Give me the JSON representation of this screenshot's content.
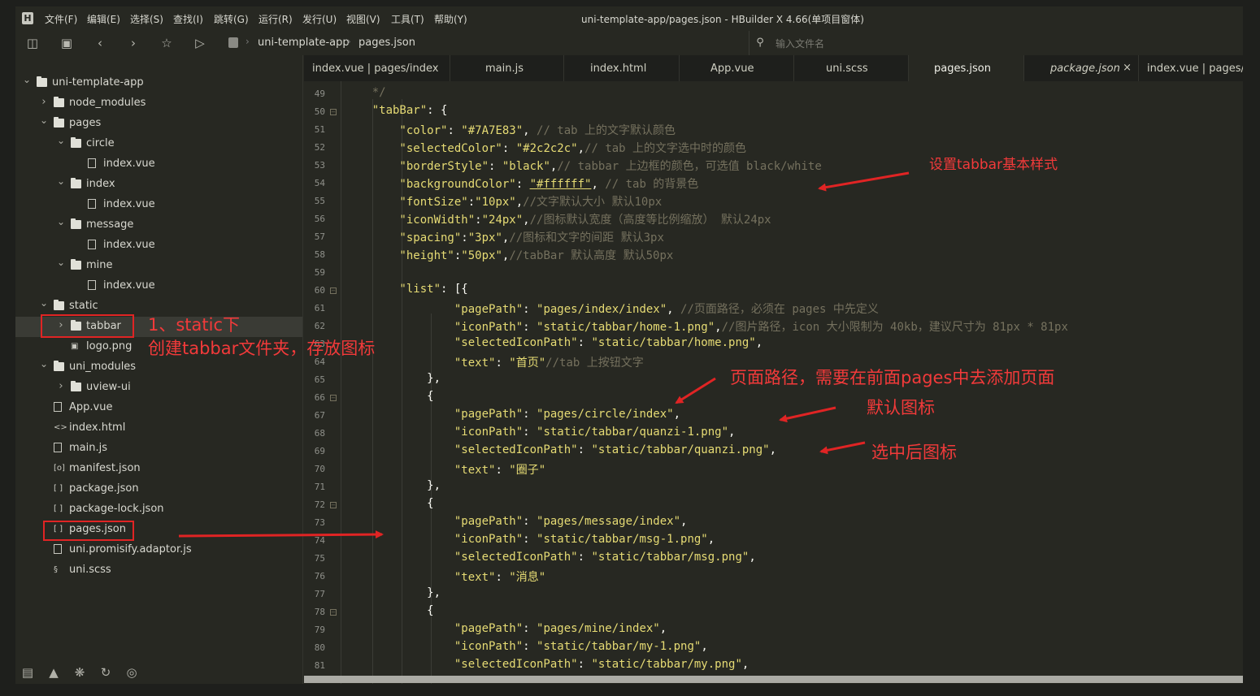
{
  "menubar": {
    "logo": "H",
    "items": [
      "文件(F)",
      "编辑(E)",
      "选择(S)",
      "查找(I)",
      "跳转(G)",
      "运行(R)",
      "发行(U)",
      "视图(V)",
      "工具(T)",
      "帮助(Y)"
    ],
    "window_title": "uni-template-app/pages.json - HBuilder X 4.66(单项目窗体)"
  },
  "toolbar": {
    "breadcrumb": [
      "uni-template-app",
      "pages.json"
    ],
    "file_search_placeholder": "输入文件名"
  },
  "sidebar": {
    "tree": [
      {
        "label": "uni-template-app",
        "kind": "folder",
        "expanded": true
      },
      {
        "label": "node_modules",
        "kind": "folder",
        "expanded": false
      },
      {
        "label": "pages",
        "kind": "folder",
        "expanded": true
      },
      {
        "label": "circle",
        "kind": "folder",
        "expanded": true
      },
      {
        "label": "index.vue",
        "kind": "vue"
      },
      {
        "label": "index",
        "kind": "folder",
        "expanded": true
      },
      {
        "label": "index.vue",
        "kind": "vue"
      },
      {
        "label": "message",
        "kind": "folder",
        "expanded": true
      },
      {
        "label": "index.vue",
        "kind": "vue"
      },
      {
        "label": "mine",
        "kind": "folder",
        "expanded": true
      },
      {
        "label": "index.vue",
        "kind": "vue"
      },
      {
        "label": "static",
        "kind": "folder",
        "expanded": true
      },
      {
        "label": "tabbar",
        "kind": "folder",
        "expanded": false,
        "selected": true
      },
      {
        "label": "logo.png",
        "kind": "image"
      },
      {
        "label": "uni_modules",
        "kind": "folder",
        "expanded": true
      },
      {
        "label": "uview-ui",
        "kind": "folder",
        "expanded": false
      },
      {
        "label": "App.vue",
        "kind": "vue"
      },
      {
        "label": "index.html",
        "kind": "html"
      },
      {
        "label": "main.js",
        "kind": "js"
      },
      {
        "label": "manifest.json",
        "kind": "manifest"
      },
      {
        "label": "package.json",
        "kind": "json"
      },
      {
        "label": "package-lock.json",
        "kind": "json"
      },
      {
        "label": "pages.json",
        "kind": "json"
      },
      {
        "label": "uni.promisify.adaptor.js",
        "kind": "js"
      },
      {
        "label": "uni.scss",
        "kind": "scss"
      }
    ]
  },
  "tabs": [
    {
      "label": "index.vue | pages/index"
    },
    {
      "label": "main.js"
    },
    {
      "label": "index.html"
    },
    {
      "label": "App.vue"
    },
    {
      "label": "uni.scss"
    },
    {
      "label": "pages.json",
      "active": true
    },
    {
      "label": "package.json",
      "italic": true,
      "close": "×"
    },
    {
      "label": "index.vue | pages/c"
    }
  ],
  "editor": {
    "lines": [
      {
        "n": "49",
        "t": [
          [
            "c",
            "    */"
          ]
        ]
      },
      {
        "n": "50",
        "fold": true,
        "t": [
          [
            "s",
            "    \"tabBar\""
          ],
          [
            "p",
            ": {"
          ]
        ]
      },
      {
        "n": "51",
        "t": [
          [
            "s",
            "        \"color\""
          ],
          [
            "p",
            ": "
          ],
          [
            "s",
            "\"#7A7E83\""
          ],
          [
            "p",
            ", "
          ],
          [
            "c",
            "// tab 上的文字默认颜色"
          ]
        ]
      },
      {
        "n": "52",
        "t": [
          [
            "s",
            "        \"selectedColor\""
          ],
          [
            "p",
            ": "
          ],
          [
            "s",
            "\"#2c2c2c\""
          ],
          [
            "p",
            ","
          ],
          [
            "c",
            "// tab 上的文字选中时的颜色"
          ]
        ]
      },
      {
        "n": "53",
        "t": [
          [
            "s",
            "        \"borderStyle\""
          ],
          [
            "p",
            ": "
          ],
          [
            "s",
            "\"black\""
          ],
          [
            "p",
            ","
          ],
          [
            "c",
            "// tabbar 上边框的颜色，可选值 black/white"
          ]
        ]
      },
      {
        "n": "54",
        "t": [
          [
            "s",
            "        \"backgroundColor\""
          ],
          [
            "p",
            ": "
          ],
          [
            "su",
            "\"#ffffff\""
          ],
          [
            "p",
            ", "
          ],
          [
            "c",
            "// tab 的背景色"
          ]
        ]
      },
      {
        "n": "55",
        "t": [
          [
            "s",
            "        \"fontSize\""
          ],
          [
            "p",
            ":"
          ],
          [
            "s",
            "\"10px\""
          ],
          [
            "p",
            ","
          ],
          [
            "c",
            "//文字默认大小 默认10px"
          ]
        ]
      },
      {
        "n": "56",
        "t": [
          [
            "s",
            "        \"iconWidth\""
          ],
          [
            "p",
            ":"
          ],
          [
            "s",
            "\"24px\""
          ],
          [
            "p",
            ","
          ],
          [
            "c",
            "//图标默认宽度（高度等比例缩放） 默认24px"
          ]
        ]
      },
      {
        "n": "57",
        "t": [
          [
            "s",
            "        \"spacing\""
          ],
          [
            "p",
            ":"
          ],
          [
            "s",
            "\"3px\""
          ],
          [
            "p",
            ","
          ],
          [
            "c",
            "//图标和文字的间距 默认3px"
          ]
        ]
      },
      {
        "n": "58",
        "t": [
          [
            "s",
            "        \"height\""
          ],
          [
            "p",
            ":"
          ],
          [
            "s",
            "\"50px\""
          ],
          [
            "p",
            ","
          ],
          [
            "c",
            "//tabBar 默认高度 默认50px"
          ]
        ]
      },
      {
        "n": "59",
        "t": []
      },
      {
        "n": "60",
        "fold": true,
        "t": [
          [
            "s",
            "        \"list\""
          ],
          [
            "p",
            ": [{"
          ]
        ]
      },
      {
        "n": "61",
        "t": [
          [
            "s",
            "                \"pagePath\""
          ],
          [
            "p",
            ": "
          ],
          [
            "s",
            "\"pages/index/index\""
          ],
          [
            "p",
            ", "
          ],
          [
            "c",
            "//页面路径，必须在 pages 中先定义"
          ]
        ]
      },
      {
        "n": "62",
        "t": [
          [
            "s",
            "                \"iconPath\""
          ],
          [
            "p",
            ": "
          ],
          [
            "s",
            "\"static/tabbar/home-1.png\""
          ],
          [
            "p",
            ","
          ],
          [
            "c",
            "//图片路径，icon 大小限制为 40kb，建议尺寸为 81px * 81px"
          ]
        ]
      },
      {
        "n": "63",
        "t": [
          [
            "s",
            "                \"selectedIconPath\""
          ],
          [
            "p",
            ": "
          ],
          [
            "s",
            "\"static/tabbar/home.png\""
          ],
          [
            "p",
            ","
          ]
        ]
      },
      {
        "n": "64",
        "t": [
          [
            "s",
            "                \"text\""
          ],
          [
            "p",
            ": "
          ],
          [
            "s",
            "\"首页\""
          ],
          [
            "c",
            "//tab 上按钮文字"
          ]
        ]
      },
      {
        "n": "65",
        "t": [
          [
            "p",
            "            },"
          ]
        ]
      },
      {
        "n": "66",
        "fold": true,
        "t": [
          [
            "p",
            "            {"
          ]
        ]
      },
      {
        "n": "67",
        "t": [
          [
            "s",
            "                \"pagePath\""
          ],
          [
            "p",
            ": "
          ],
          [
            "s",
            "\"pages/circle/index\""
          ],
          [
            "p",
            ","
          ]
        ]
      },
      {
        "n": "68",
        "t": [
          [
            "s",
            "                \"iconPath\""
          ],
          [
            "p",
            ": "
          ],
          [
            "s",
            "\"static/tabbar/quanzi-1.png\""
          ],
          [
            "p",
            ","
          ]
        ]
      },
      {
        "n": "69",
        "t": [
          [
            "s",
            "                \"selectedIconPath\""
          ],
          [
            "p",
            ": "
          ],
          [
            "s",
            "\"static/tabbar/quanzi.png\""
          ],
          [
            "p",
            ","
          ]
        ]
      },
      {
        "n": "70",
        "t": [
          [
            "s",
            "                \"text\""
          ],
          [
            "p",
            ": "
          ],
          [
            "s",
            "\"圈子\""
          ]
        ]
      },
      {
        "n": "71",
        "t": [
          [
            "p",
            "            },"
          ]
        ]
      },
      {
        "n": "72",
        "fold": true,
        "t": [
          [
            "p",
            "            {"
          ]
        ]
      },
      {
        "n": "73",
        "t": [
          [
            "s",
            "                \"pagePath\""
          ],
          [
            "p",
            ": "
          ],
          [
            "s",
            "\"pages/message/index\""
          ],
          [
            "p",
            ","
          ]
        ]
      },
      {
        "n": "74",
        "t": [
          [
            "s",
            "                \"iconPath\""
          ],
          [
            "p",
            ": "
          ],
          [
            "s",
            "\"static/tabbar/msg-1.png\""
          ],
          [
            "p",
            ","
          ]
        ]
      },
      {
        "n": "75",
        "t": [
          [
            "s",
            "                \"selectedIconPath\""
          ],
          [
            "p",
            ": "
          ],
          [
            "s",
            "\"static/tabbar/msg.png\""
          ],
          [
            "p",
            ","
          ]
        ]
      },
      {
        "n": "76",
        "t": [
          [
            "s",
            "                \"text\""
          ],
          [
            "p",
            ": "
          ],
          [
            "s",
            "\"消息\""
          ]
        ]
      },
      {
        "n": "77",
        "t": [
          [
            "p",
            "            },"
          ]
        ]
      },
      {
        "n": "78",
        "fold": true,
        "t": [
          [
            "p",
            "            {"
          ]
        ]
      },
      {
        "n": "79",
        "t": [
          [
            "s",
            "                \"pagePath\""
          ],
          [
            "p",
            ": "
          ],
          [
            "s",
            "\"pages/mine/index\""
          ],
          [
            "p",
            ","
          ]
        ]
      },
      {
        "n": "80",
        "t": [
          [
            "s",
            "                \"iconPath\""
          ],
          [
            "p",
            ": "
          ],
          [
            "s",
            "\"static/tabbar/my-1.png\""
          ],
          [
            "p",
            ","
          ]
        ]
      },
      {
        "n": "81",
        "t": [
          [
            "s",
            "                \"selectedIconPath\""
          ],
          [
            "p",
            ": "
          ],
          [
            "s",
            "\"static/tabbar/my.png\""
          ],
          [
            "p",
            ","
          ]
        ]
      }
    ]
  },
  "annotations": {
    "tabbar_style": "设置tabbar基本样式",
    "static_line1": "1、static下",
    "static_line2": "创建tabbar文件夹，存放图标",
    "page_path": "页面路径，需要在前面pages中去添加页面",
    "default_icon": "默认图标",
    "selected_icon": "选中后图标",
    "color": "#f23a3a"
  },
  "colors": {
    "background": "#272822",
    "string": "#e6db74",
    "comment": "#75715e",
    "annotation": "#e02424"
  }
}
